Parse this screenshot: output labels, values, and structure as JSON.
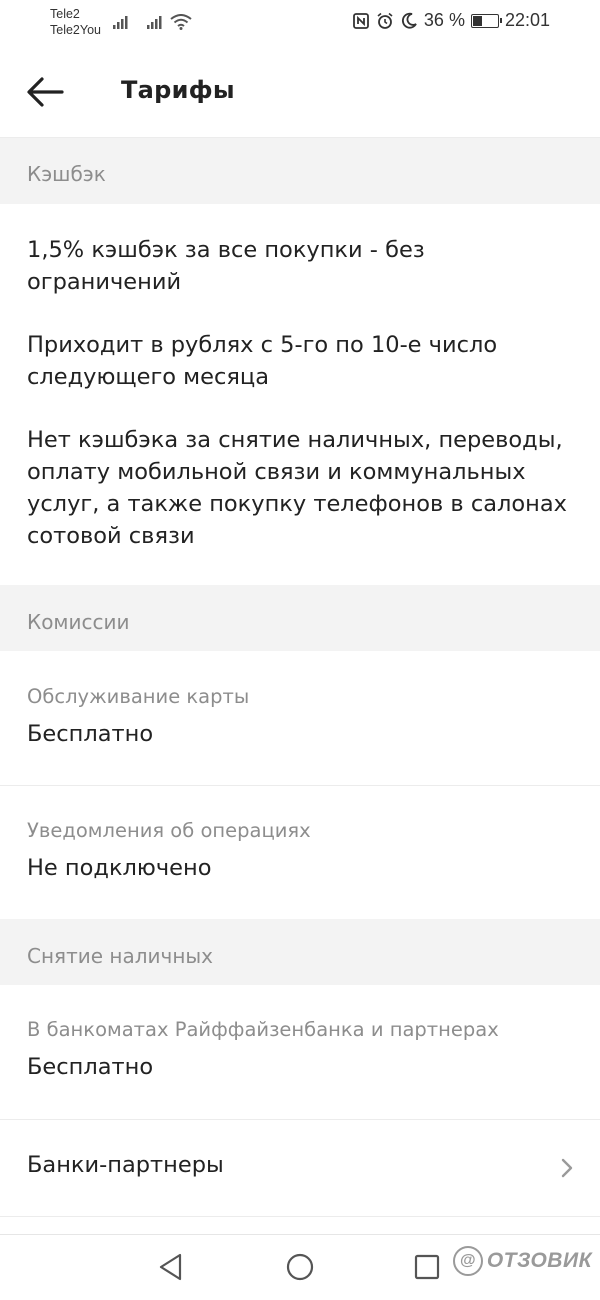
{
  "status_bar": {
    "carrier_1": "Tele2",
    "carrier_2": "Tele2You",
    "battery_percent": "36 %",
    "battery_level": 0.36,
    "time": "22:01",
    "icons": [
      "signal-icon",
      "signal-icon",
      "wifi-icon",
      "nfc-icon",
      "alarm-icon",
      "moon-icon",
      "battery-icon"
    ]
  },
  "app_bar": {
    "back_icon": "arrow-left-icon",
    "title": "Тарифы"
  },
  "sections": {
    "cashback": {
      "header": "Кэшбэк",
      "paragraphs": [
        "1,5% кэшбэк за все покупки - без ограничений",
        "Приходит в рублях с 5-го по 10-е число следующего месяца",
        "Нет кэшбэка за снятие наличных, переводы, оплату мобильной связи и коммунальных услуг, а также покупку телефонов в салонах сотовой связи"
      ]
    },
    "commissions": {
      "header": "Комиссии",
      "rows": [
        {
          "label": "Обслуживание карты",
          "value": "Бесплатно"
        },
        {
          "label": "Уведомления об операциях",
          "value": "Не подключено"
        }
      ]
    },
    "cash_withdrawal": {
      "header": "Снятие наличных",
      "rows": [
        {
          "label": "В банкоматах Райффайзенбанка и партнерах",
          "value": "Бесплатно"
        }
      ],
      "link": {
        "label": "Банки-партнеры",
        "icon": "chevron-right-icon"
      }
    }
  },
  "nav_bar": {
    "icons": [
      "back-triangle-icon",
      "home-circle-icon",
      "recents-square-icon"
    ]
  },
  "watermark": {
    "text": "ОТЗОВИК",
    "badge": "@"
  },
  "colors": {
    "header_bg": "#f3f3f3",
    "muted_text": "#8d8d8d",
    "primary_text": "#222222"
  }
}
